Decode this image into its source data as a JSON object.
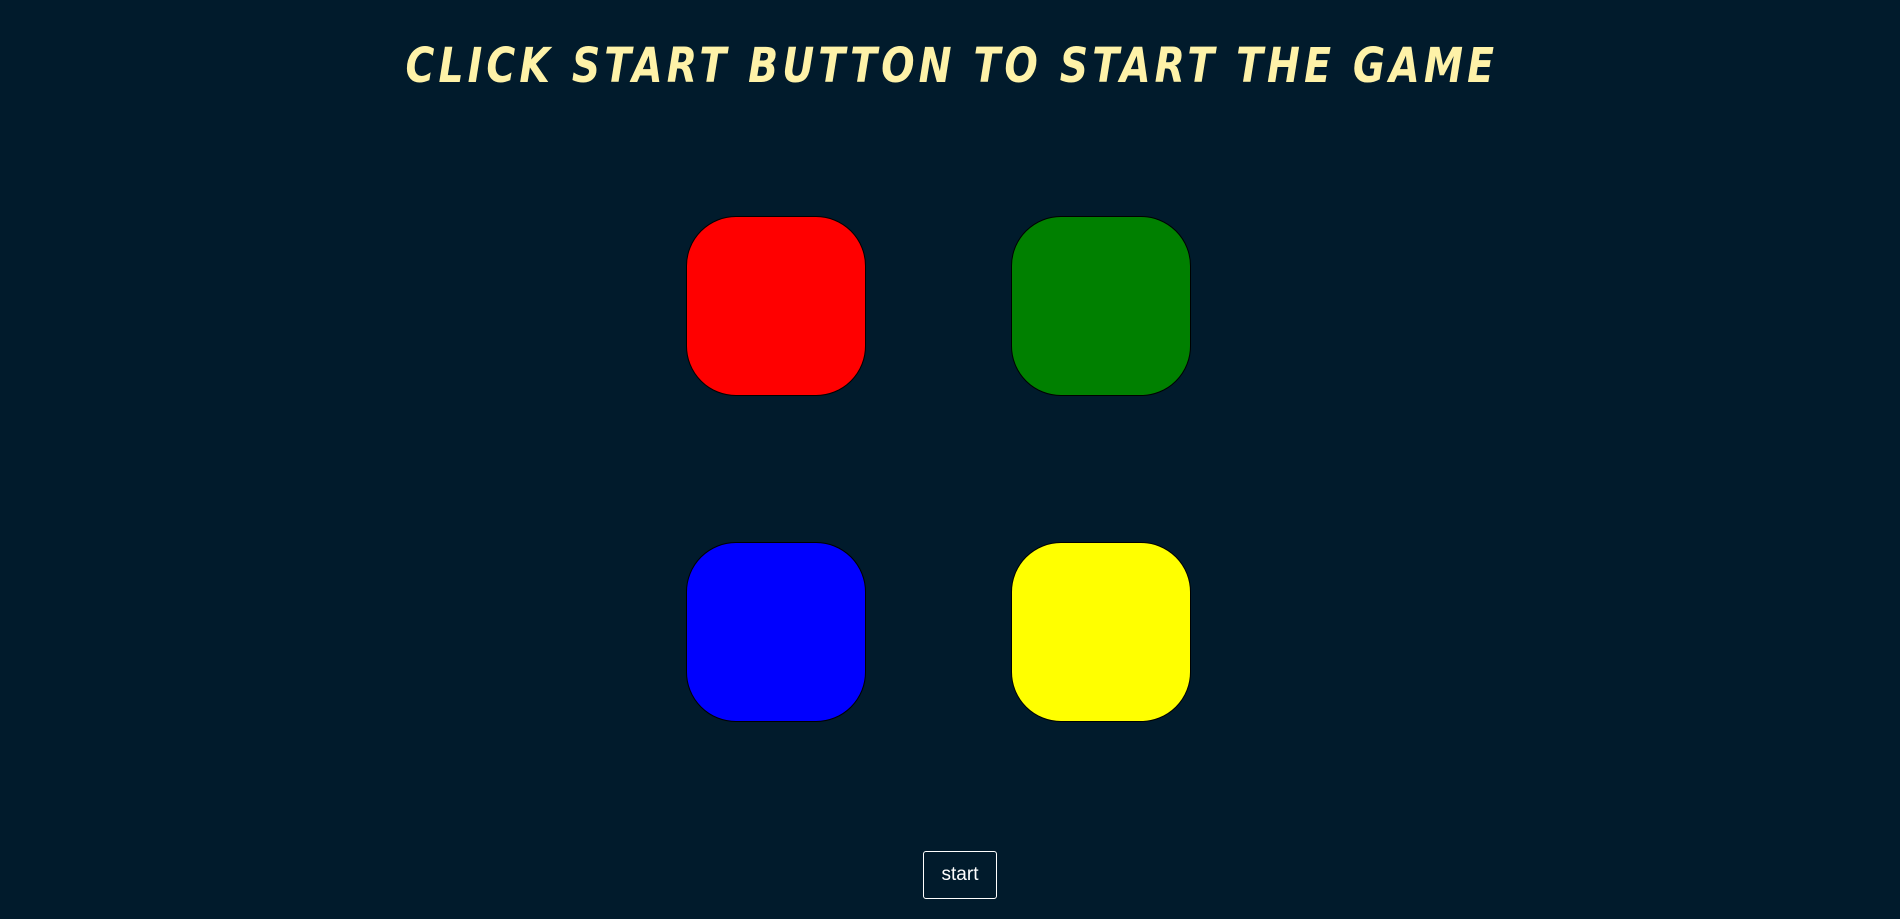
{
  "header": {
    "title": "Click start button to start the game"
  },
  "pads": [
    {
      "color_name": "red",
      "color": "#ff0000"
    },
    {
      "color_name": "green",
      "color": "#008000"
    },
    {
      "color_name": "blue",
      "color": "#0000ff"
    },
    {
      "color_name": "yellow",
      "color": "#ffff00"
    }
  ],
  "controls": {
    "start_label": "start"
  },
  "theme": {
    "background": "#011b2c",
    "title_color": "#fef2a8"
  }
}
